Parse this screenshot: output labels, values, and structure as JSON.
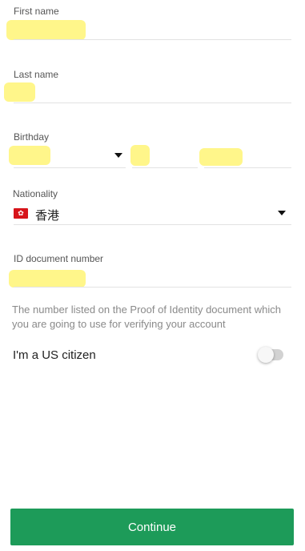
{
  "form": {
    "first_name": {
      "label": "First name"
    },
    "last_name": {
      "label": "Last name"
    },
    "birthday": {
      "label": "Birthday"
    },
    "nationality": {
      "label": "Nationality",
      "value": "香港",
      "flag_icon": "hong-kong-flag-icon"
    },
    "id_document": {
      "label": "ID document number"
    },
    "hint_text": "The number listed on the Proof of Identity document which you are going to use for verifying your account",
    "us_citizen": {
      "label": "I'm a US citizen",
      "checked": false
    }
  },
  "actions": {
    "continue_label": "Continue"
  },
  "colors": {
    "accent": "#1d9b59",
    "redaction": "#fff68a",
    "hint": "#8a8a8a"
  }
}
